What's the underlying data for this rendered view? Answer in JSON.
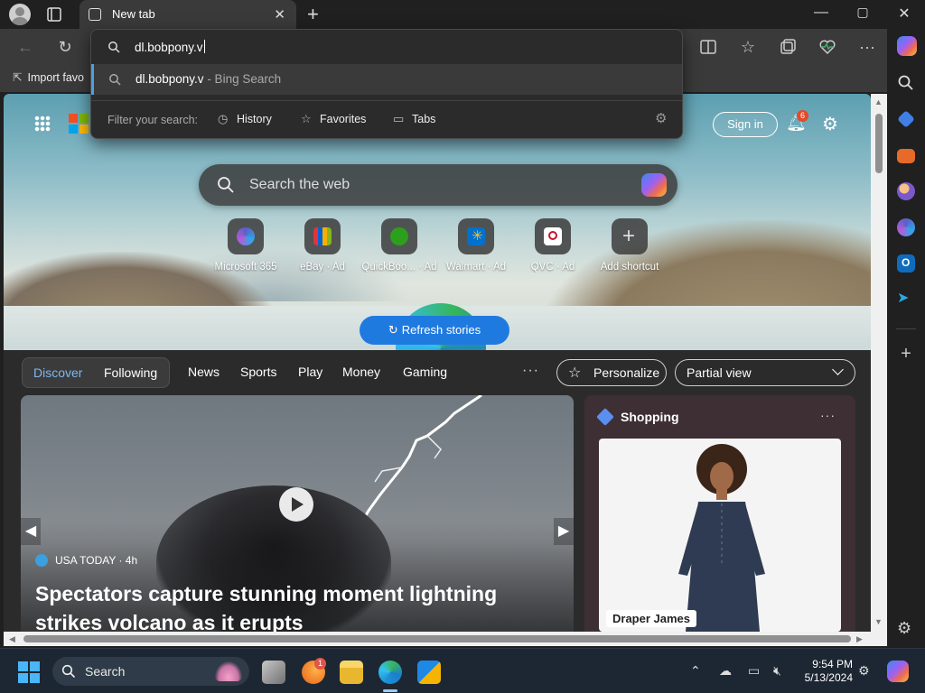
{
  "browser": {
    "tab_title": "New tab",
    "new_tab_symbol": "+",
    "window_controls": {
      "minimize": "—",
      "maximize": "▢",
      "close": "✕"
    },
    "favorites_bar_item": "Import favo"
  },
  "omnibox": {
    "typed": "dl.bobpony.v",
    "suggestion_main": "dl.bobpony.v",
    "suggestion_sub": " - Bing Search",
    "filter_label": "Filter your search:",
    "filters": [
      "History",
      "Favorites",
      "Tabs"
    ]
  },
  "ntp": {
    "sign_in": "Sign in",
    "notification_count": "6",
    "search_placeholder": "Search the web",
    "shortcuts": [
      {
        "name": "Microsoft 365",
        "color": "#5b5fc7"
      },
      {
        "name": "eBay · Ad",
        "color": "#e53238"
      },
      {
        "name": "QuickBoo... · Ad",
        "color": "#2ca01c"
      },
      {
        "name": "Walmart · Ad",
        "color": "#0071ce"
      },
      {
        "name": "QVC · Ad",
        "color": "#ffffff"
      },
      {
        "name": "Add shortcut",
        "color": "transparent"
      }
    ]
  },
  "feed": {
    "pills": [
      "Discover",
      "Following"
    ],
    "nav": [
      "News",
      "Sports",
      "Play",
      "Money",
      "Gaming"
    ],
    "more": "···",
    "personalize": "Personalize",
    "view": "Partial view",
    "refresh": "Refresh stories",
    "story": {
      "source": "USA TODAY · 4h",
      "headline": "Spectators capture stunning moment lightning strikes volcano as it erupts"
    },
    "shopping": {
      "title": "Shopping",
      "more": "···",
      "brand": "Draper James"
    }
  },
  "taskbar": {
    "search_label": "Search",
    "time": "9:54 PM",
    "date": "5/13/2024",
    "notify_badge": "1"
  },
  "colors": {
    "accent": "#1f7ae0",
    "discover_text": "#7fb6f0"
  }
}
